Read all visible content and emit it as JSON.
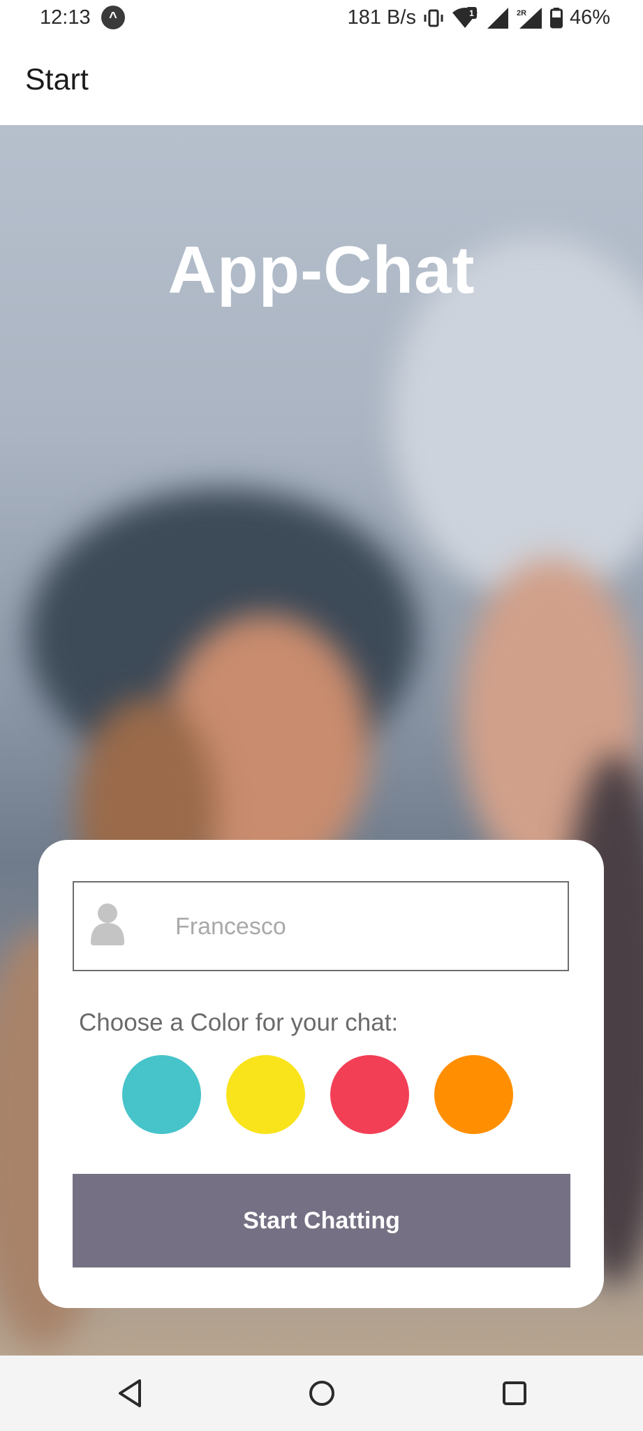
{
  "status_bar": {
    "time": "12:13",
    "app_icon": "arrow-up-circle-icon",
    "net_speed": "181 B/s",
    "sim_badge": "1",
    "roaming_badge": "2R",
    "battery": "46%"
  },
  "app_bar": {
    "title": "Start"
  },
  "hero": {
    "title": "App-Chat"
  },
  "form": {
    "name_value": "Francesco",
    "color_label": "Choose a Color for your chat:",
    "colors": [
      "#47C3CA",
      "#F9E31B",
      "#F23F56",
      "#FF8F00"
    ],
    "button_label": "Start Chatting",
    "button_color": "#757083"
  },
  "nav_bar": {
    "back": "back-icon",
    "home": "home-icon",
    "recents": "recents-icon"
  }
}
